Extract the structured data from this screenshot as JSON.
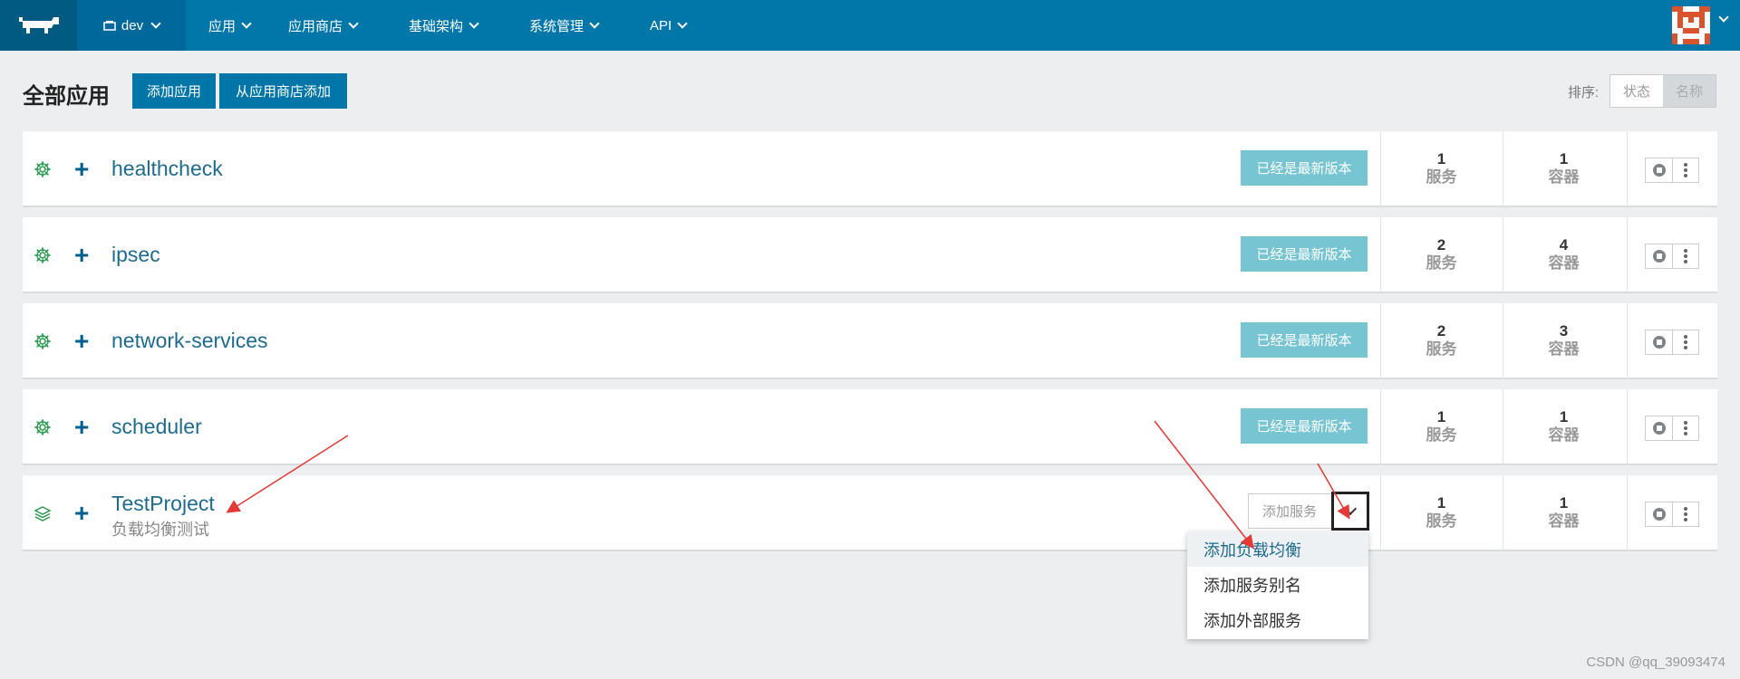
{
  "nav": {
    "env": "dev",
    "items": [
      "应用",
      "应用商店",
      "基础架构",
      "系统管理",
      "API"
    ]
  },
  "header": {
    "title": "全部应用",
    "add_app": "添加应用",
    "add_from_catalog": "从应用商店添加",
    "sort_label": "排序:",
    "sort_options": [
      "状态",
      "名称"
    ],
    "sort_selected": "名称"
  },
  "stacks": [
    {
      "name": "healthcheck",
      "description": "",
      "status": "已经是最新版本",
      "services": "1",
      "services_label": "服务",
      "containers": "1",
      "containers_label": "容器",
      "icon": "gear-icon"
    },
    {
      "name": "ipsec",
      "description": "",
      "status": "已经是最新版本",
      "services": "2",
      "services_label": "服务",
      "containers": "4",
      "containers_label": "容器",
      "icon": "gear-icon"
    },
    {
      "name": "network-services",
      "description": "",
      "status": "已经是最新版本",
      "services": "2",
      "services_label": "服务",
      "containers": "3",
      "containers_label": "容器",
      "icon": "gear-icon"
    },
    {
      "name": "scheduler",
      "description": "",
      "status": "已经是最新版本",
      "services": "1",
      "services_label": "服务",
      "containers": "1",
      "containers_label": "容器",
      "icon": "gear-icon"
    },
    {
      "name": "TestProject",
      "description": "负载均衡测试",
      "add_service": "添加服务",
      "services": "1",
      "services_label": "服务",
      "containers": "1",
      "containers_label": "容器",
      "icon": "layers-icon"
    }
  ],
  "dropdown": {
    "items": [
      "添加负载均衡",
      "添加服务别名",
      "添加外部服务"
    ],
    "active_index": 0
  },
  "watermark": "CSDN @qq_39093474",
  "colors": {
    "nav_bg": "#0077a8",
    "primary": "#0075a8",
    "upgrade": "#77c5d2",
    "link": "#1e6b8f",
    "gear": "#2e9a52"
  }
}
